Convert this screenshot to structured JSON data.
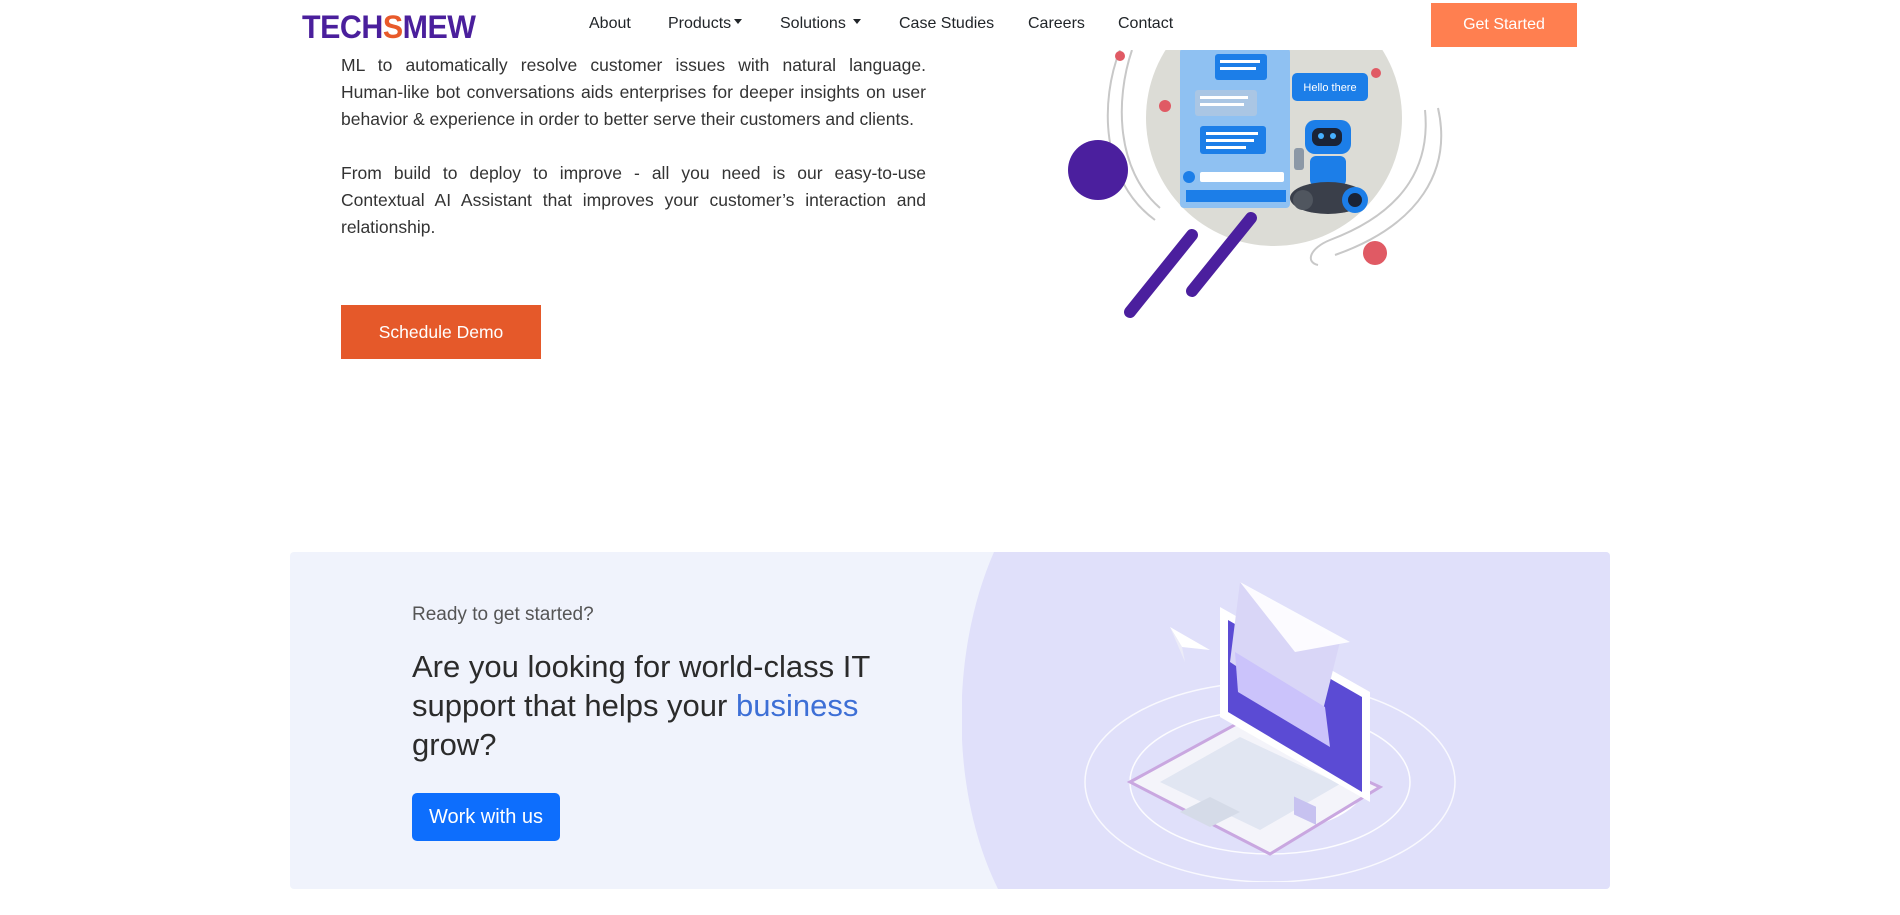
{
  "navbar": {
    "logo": {
      "part1": "TECH",
      "accent": "S",
      "part2": "MEW"
    },
    "links": [
      {
        "label": "About",
        "dropdown": false
      },
      {
        "label": "Products",
        "dropdown": true
      },
      {
        "label": "Solutions",
        "dropdown": true
      },
      {
        "label": "Case Studies",
        "dropdown": false
      },
      {
        "label": "Careers",
        "dropdown": false
      },
      {
        "label": "Contact",
        "dropdown": false
      }
    ],
    "cta_label": "Get Started"
  },
  "hero": {
    "paragraph_1": "ML to automatically resolve customer issues with natural language. Human-like bot conversations aids enterprises for deeper insights on user behavior & experience in order to better serve their customers and clients.",
    "paragraph_2": "From build to deploy to improve - all you need is our easy-to-use Contextual AI Assistant that improves your customer’s interaction and relationship.",
    "button_label": "Schedule Demo",
    "illustration": {
      "bubble_text": "Hello there"
    }
  },
  "cta": {
    "eyebrow": "Ready to get started?",
    "heading_part1": "Are you looking for world-class IT support that helps your ",
    "heading_accent": "business",
    "heading_part2": " grow?",
    "button_label": "Work with us"
  },
  "colors": {
    "brand_purple": "#4a1f9c",
    "get_started_orange": "#ff7f50",
    "demo_orange": "#e5592a",
    "primary_blue": "#0d6efd",
    "accent_blue_text": "#3d6fd6",
    "cta_background": "#f0f3fc"
  }
}
